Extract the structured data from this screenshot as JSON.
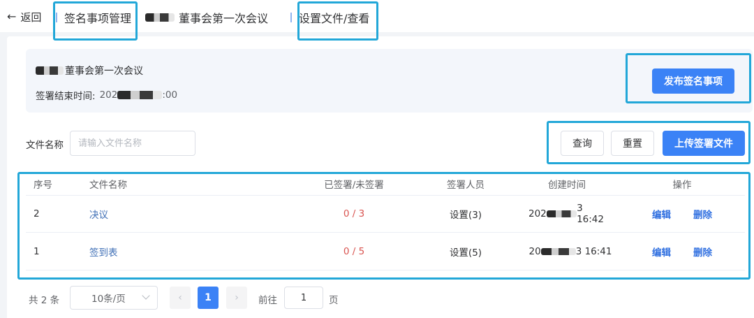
{
  "header": {
    "back_label": "返回",
    "breadcrumb": [
      "签名事项管理",
      "董事会第一次会议",
      "设置文件/查看"
    ]
  },
  "meeting": {
    "name": "董事会第一次会议",
    "end_time_label": "签署结束时间:",
    "end_time_prefix": "202",
    "end_time_suffix": ":00",
    "publish_button": "发布签名事项"
  },
  "filter": {
    "label": "文件名称",
    "placeholder": "请输入文件名称",
    "query_button": "查询",
    "reset_button": "重置",
    "upload_button": "上传签署文件"
  },
  "table": {
    "headers": [
      "序号",
      "文件名称",
      "已签署/未签署",
      "签署人员",
      "创建时间",
      "操作"
    ],
    "rows": [
      {
        "seq": "2",
        "name": "决议",
        "signed": "0 / 3",
        "signer": "设置(3)",
        "created_prefix": "202",
        "created_suffix": "3 16:42",
        "edit": "编辑",
        "delete": "删除"
      },
      {
        "seq": "1",
        "name": "签到表",
        "signed": "0 / 5",
        "signer": "设置(5)",
        "created_prefix": "20",
        "created_suffix": "3 16:41",
        "edit": "编辑",
        "delete": "删除"
      }
    ]
  },
  "pagination": {
    "total": "共 2 条",
    "page_size": "10条/页",
    "current_page": "1",
    "goto_label": "前往",
    "goto_value": "1",
    "goto_unit": "页"
  },
  "colors": {
    "primary": "#3b82f6",
    "highlight_border": "#22a7d8",
    "danger_count": "#d9534f"
  }
}
